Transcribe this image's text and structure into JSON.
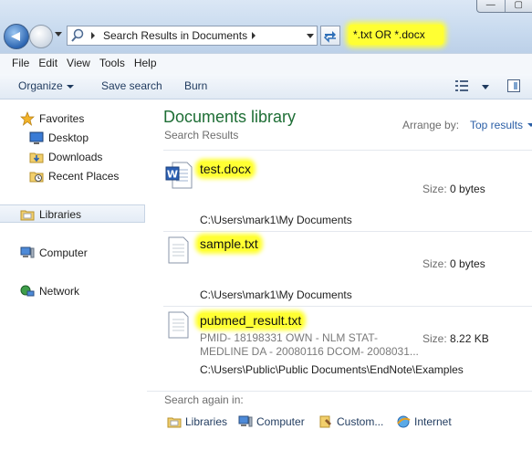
{
  "address_bar": {
    "breadcrumb": "Search Results in Documents"
  },
  "search": {
    "query": "*.txt OR *.docx"
  },
  "menubar": {
    "items": [
      "File",
      "Edit",
      "View",
      "Tools",
      "Help"
    ]
  },
  "toolbar": {
    "organize": "Organize",
    "save_search": "Save search",
    "burn": "Burn"
  },
  "navigation": {
    "favorites": "Favorites",
    "desktop": "Desktop",
    "downloads": "Downloads",
    "recent_places": "Recent Places",
    "libraries": "Libraries",
    "computer": "Computer",
    "network": "Network"
  },
  "content": {
    "title": "Documents library",
    "subtitle": "Search Results",
    "arrange_by_label": "Arrange by:",
    "arrange_by_value": "Top results",
    "size_label": "Size:",
    "results": [
      {
        "name": "test.docx",
        "size": "0 bytes",
        "path": "C:\\Users\\mark1\\My Documents",
        "snippet": []
      },
      {
        "name": "sample.txt",
        "size": "0 bytes",
        "path": "C:\\Users\\mark1\\My Documents",
        "snippet": []
      },
      {
        "name": "pubmed_result.txt",
        "size": "8.22 KB",
        "path": "C:\\Users\\Public\\Public Documents\\EndNote\\Examples",
        "snippet": [
          "PMID- 18198331 OWN - NLM STAT-",
          "MEDLINE DA - 20080116 DCOM- 2008031..."
        ]
      }
    ],
    "search_again": {
      "label": "Search again in:",
      "options": [
        "Libraries",
        "Computer",
        "Custom...",
        "Internet"
      ]
    }
  },
  "colors": {
    "highlight": "#ffff33",
    "library_title": "#1e6e35",
    "link": "#2a5ea6"
  }
}
